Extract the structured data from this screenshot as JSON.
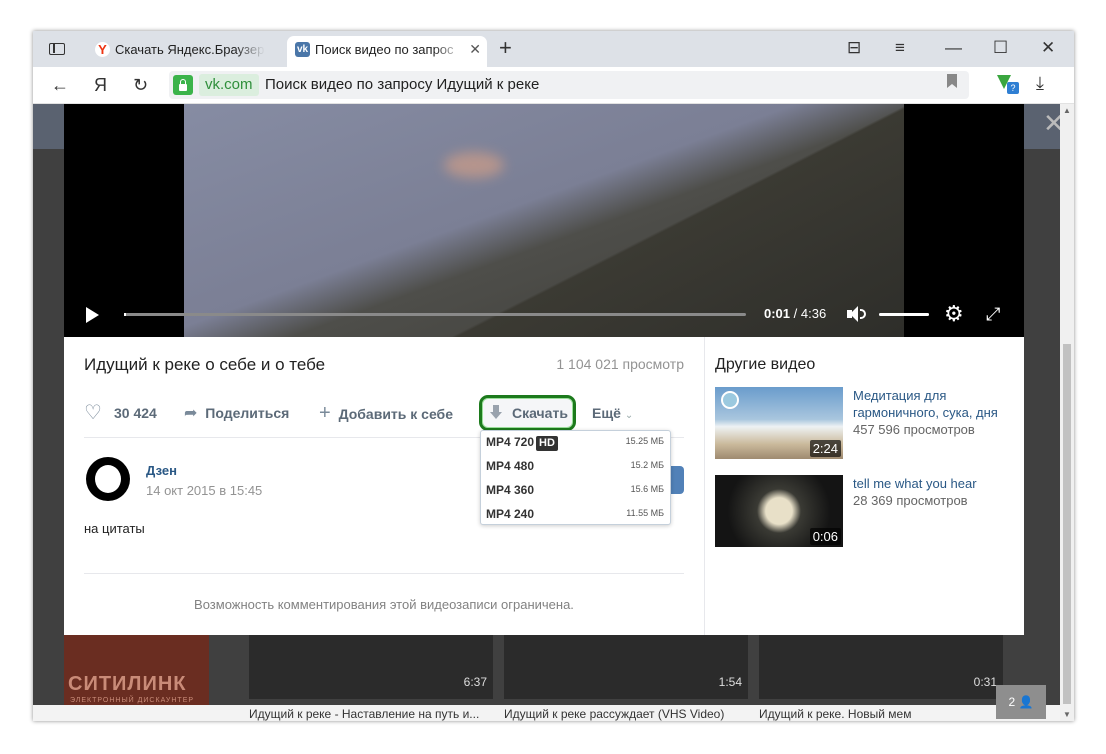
{
  "browser": {
    "tabs": [
      {
        "title": "Скачать Яндекс.Браузер д"
      },
      {
        "title": "Поиск видео по запрос"
      }
    ],
    "new_tab_label": "+",
    "address": {
      "domain": "vk.com",
      "text": "Поиск видео по запросу Идущий к реке"
    },
    "ext_badge": "?"
  },
  "player": {
    "current_time": "0:01",
    "duration": "/ 4:36",
    "progress": 0.004,
    "volume": 1.0
  },
  "video": {
    "title": "Идущий к реке о себе и о тебе",
    "views": "1 104 021 просмотр",
    "likes": "30 424",
    "share_label": "Поделиться",
    "add_label": "Добавить к себе",
    "download_label": "Скачать",
    "more_label": "Ещё",
    "author": "Дзен",
    "date": "14 окт 2015 в 15:45",
    "description": "на цитаты",
    "comments_note": "Возможность комментирования этой видеозаписи ограничена."
  },
  "download_menu": [
    {
      "label": "MP4 720",
      "badge": "HD",
      "size": "15.25 МБ"
    },
    {
      "label": "MP4 480",
      "badge": "",
      "size": "15.2 МБ"
    },
    {
      "label": "MP4 360",
      "badge": "",
      "size": "15.6 МБ"
    },
    {
      "label": "MP4 240",
      "badge": "",
      "size": "11.55 МБ"
    }
  ],
  "other_videos": {
    "title": "Другие видео",
    "items": [
      {
        "title": "Медитация для гармоничного, сука, дня",
        "views": "457 596 просмотров",
        "duration": "2:24"
      },
      {
        "title": "tell me what you hear",
        "views": "28 369 просмотров",
        "duration": "0:06"
      }
    ]
  },
  "related": {
    "ad": {
      "big": "СИТИЛИНК",
      "small": "ЭЛЕКТРОННЫЙ ДИСКАУНТЕР"
    },
    "tiles": [
      {
        "duration": "6:37",
        "title": "Идущий к реке - Наставление на путь и..."
      },
      {
        "duration": "1:54",
        "title": "Идущий к реке рассуждает (VHS Video)"
      },
      {
        "duration": "0:31",
        "title": "Идущий к реке. Новый мем"
      }
    ],
    "pager_count": "2"
  }
}
